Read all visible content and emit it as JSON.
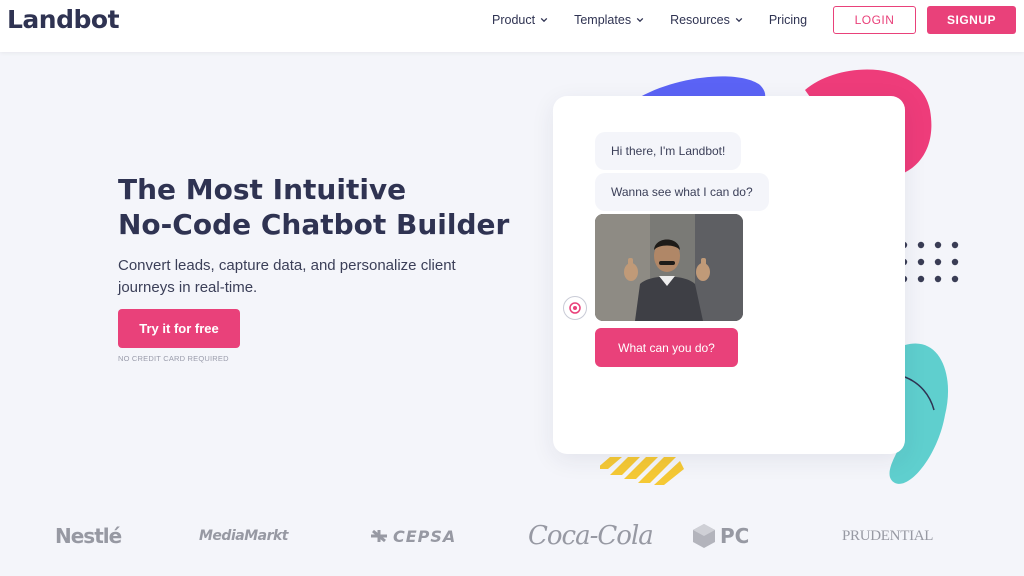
{
  "header": {
    "logo_text": "Landbot",
    "nav": [
      {
        "label": "Product",
        "has_dropdown": true
      },
      {
        "label": "Templates",
        "has_dropdown": true
      },
      {
        "label": "Resources",
        "has_dropdown": true
      },
      {
        "label": "Pricing",
        "has_dropdown": false
      }
    ],
    "login_label": "LOGIN",
    "signup_label": "SIGNUP"
  },
  "hero": {
    "title_line1": "The Most Intuitive",
    "title_line2": "No-Code Chatbot Builder",
    "subtitle": "Convert leads, capture data, and personalize client journeys in real-time.",
    "cta_label": "Try it for free",
    "cta_note": "NO CREDIT CARD REQUIRED"
  },
  "chat": {
    "messages": [
      "Hi there, I'm Landbot!",
      "Wanna see what I can do?"
    ],
    "reply_button": "What can you do?"
  },
  "logos": [
    "Nestlé",
    "MediaMarkt",
    "CEPSA",
    "Coca-Cola",
    "PC",
    "PRUDENTIAL"
  ],
  "colors": {
    "accent": "#e9417a",
    "text_dark": "#2f3352",
    "background": "#f4f5fa",
    "deco_purple": "#5b63f5",
    "deco_pink": "#ee3c7a",
    "deco_teal": "#5fcfce",
    "deco_yellow": "#f5c935"
  }
}
